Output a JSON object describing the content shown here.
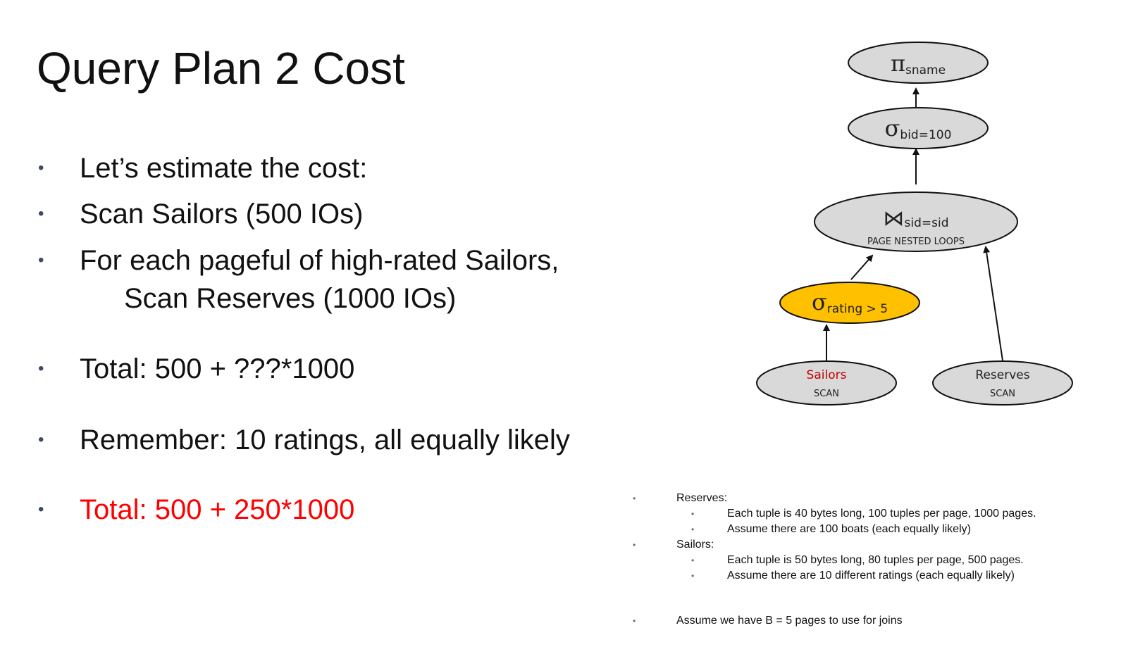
{
  "title": "Query Plan 2 Cost",
  "bullet_glyph": "•",
  "bullets": [
    {
      "line1": "Let’s estimate the cost:"
    },
    {
      "line1": "Scan Sailors (500 IOs)"
    },
    {
      "line1": "For each pageful of high-rated Sailors,",
      "line2": "Scan Reserves (1000 IOs)"
    },
    {
      "line1": "Total: 500 + ???*1000"
    },
    {
      "line1": "Remember: 10 ratings, all equally likely"
    },
    {
      "line1": "Total: 500 + 250*1000",
      "color": "#ff0000"
    }
  ],
  "diagram": {
    "project": {
      "symbol": "π",
      "sub": "sname"
    },
    "select_bid": {
      "symbol": "σ",
      "sub": "bid=100"
    },
    "join": {
      "symbol": "⋈",
      "sub": "sid=sid",
      "method": "PAGE NESTED LOOPS"
    },
    "select_rating": {
      "symbol": "σ",
      "sub": "rating > 5",
      "fill": "#ffc000"
    },
    "sailors": {
      "name": "Sailors",
      "op": "SCAN",
      "name_color": "#c00000"
    },
    "reserves": {
      "name": "Reserves",
      "op": "SCAN"
    },
    "node_fill": "#d9d9d9"
  },
  "notes": {
    "reserves_label": "Reserves:",
    "reserves_items": [
      "Each tuple is 40 bytes long,  100 tuples per page, 1000 pages.",
      "Assume there are 100 boats (each equally likely)"
    ],
    "sailors_label": "Sailors:",
    "sailors_items": [
      "Each tuple is 50 bytes long,  80 tuples per page, 500 pages.",
      "Assume there are 10 different ratings (each equally likely)"
    ],
    "buffer_note": "Assume we have B = 5 pages to use for joins"
  }
}
